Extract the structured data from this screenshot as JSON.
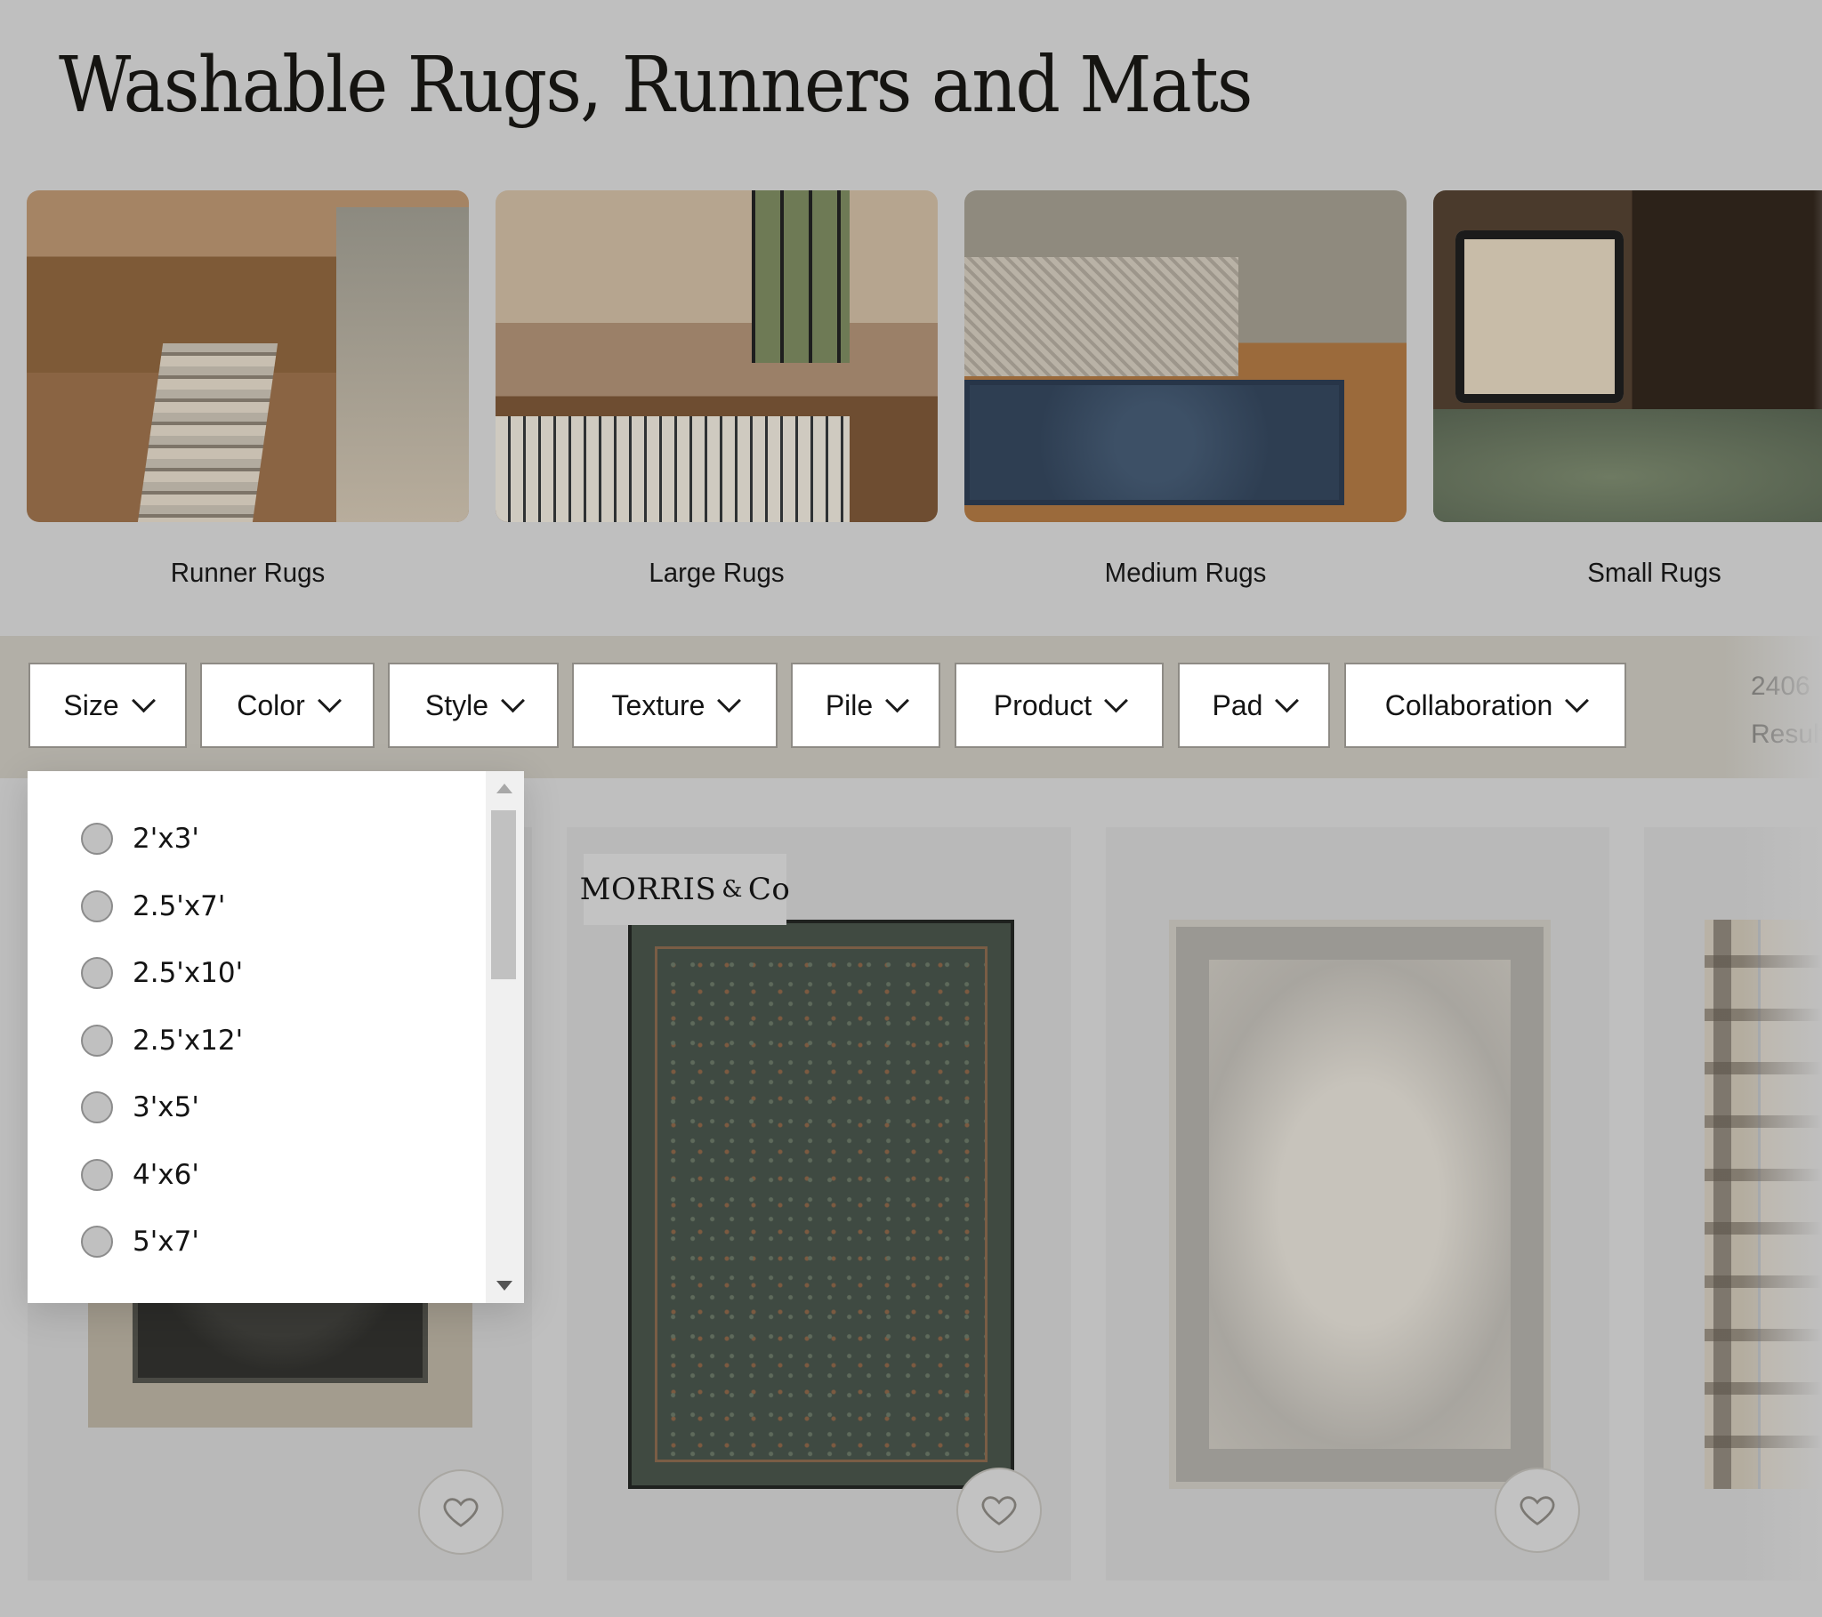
{
  "page": {
    "title": "Washable Rugs, Runners and Mats"
  },
  "categories": [
    {
      "label": "Runner Rugs",
      "image": "kitchen-runner-photo"
    },
    {
      "label": "Large Rugs",
      "image": "living-room-photo"
    },
    {
      "label": "Medium Rugs",
      "image": "bedroom-photo"
    },
    {
      "label": "Small Rugs",
      "image": "reading-nook-photo"
    }
  ],
  "filters": [
    {
      "label": "Size",
      "expanded": true
    },
    {
      "label": "Color"
    },
    {
      "label": "Style"
    },
    {
      "label": "Texture"
    },
    {
      "label": "Pile"
    },
    {
      "label": "Product"
    },
    {
      "label": "Pad"
    },
    {
      "label": "Collaboration"
    }
  ],
  "results": {
    "count": "2406",
    "label": "Results"
  },
  "size_dropdown": {
    "options": [
      "2'x3'",
      "2.5'x7'",
      "2.5'x10'",
      "2.5'x12'",
      "3'x5'",
      "4'x6'",
      "5'x7'"
    ],
    "selected": null,
    "scroll_position": 0.0
  },
  "products": [
    {
      "brand": "",
      "image": "dark-charcoal-tribal-rug",
      "favorite": false
    },
    {
      "brand": "MORRIS & Co",
      "brand_main": "MORRIS",
      "brand_amp": "&",
      "brand_co": "Co",
      "image": "green-floral-morris-rug",
      "favorite": false
    },
    {
      "brand": "",
      "image": "ivory-grey-medallion-rug",
      "favorite": false
    },
    {
      "brand": "",
      "image": "beige-plaid-runner",
      "favorite": false
    }
  ],
  "colors": {
    "overlay_bg": "#bfbfbf",
    "filter_bar_bg": "#b2afa7",
    "button_bg": "#ffffff",
    "text": "#141414"
  }
}
